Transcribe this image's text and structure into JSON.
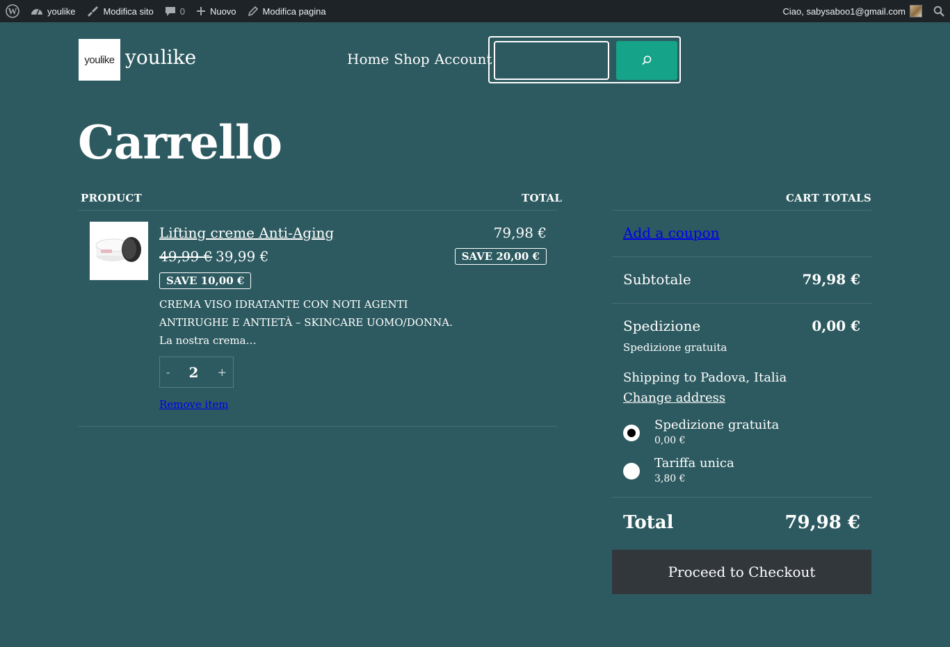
{
  "adminbar": {
    "site_name": "youlike",
    "edit_site": "Modifica sito",
    "comments_count": "0",
    "new_label": "Nuovo",
    "edit_page": "Modifica pagina",
    "greeting": "Ciao, sabysaboo1@gmail.com"
  },
  "header": {
    "logo_text": "youlike",
    "site_title": "youlike",
    "nav": [
      "Home",
      "Shop",
      "Account"
    ],
    "search_placeholder": ""
  },
  "page_title": "Carrello",
  "cart": {
    "col_product": "PRODUCT",
    "col_total": "TOTAL",
    "items": [
      {
        "name": "Lifting creme Anti-Aging",
        "price_old": "49,99 €",
        "price_new": "39,99 €",
        "save_unit": "SAVE 10,00 €",
        "description": "CREMA VISO IDRATANTE CON NOTI AGENTI ANTIRUGHE E ANTIETÀ – SKINCARE UOMO/DONNA. La nostra crema…",
        "quantity": "2",
        "qty_minus": "-",
        "qty_plus": "+",
        "remove": "Remove item",
        "line_total": "79,98 €",
        "save_total": "SAVE 20,00 €"
      }
    ]
  },
  "totals": {
    "heading": "CART TOTALS",
    "coupon": "Add a coupon",
    "subtotal_label": "Subtotale",
    "subtotal_value": "79,98 €",
    "shipping_label": "Spedizione",
    "shipping_value": "0,00 €",
    "shipping_method": "Spedizione gratuita",
    "shipping_to": "Shipping to Padova, Italia",
    "change_address": "Change address",
    "options": [
      {
        "label": "Spedizione gratuita",
        "price": "0,00 €",
        "selected": true
      },
      {
        "label": "Tariffa unica",
        "price": "3,80 €",
        "selected": false
      }
    ],
    "total_label": "Total",
    "total_value": "79,98 €",
    "checkout": "Proceed to Checkout"
  },
  "colors": {
    "background": "#2d5a60",
    "admin_bar": "#1d2327",
    "search_button": "#15a389",
    "checkout_button": "#32373c"
  }
}
